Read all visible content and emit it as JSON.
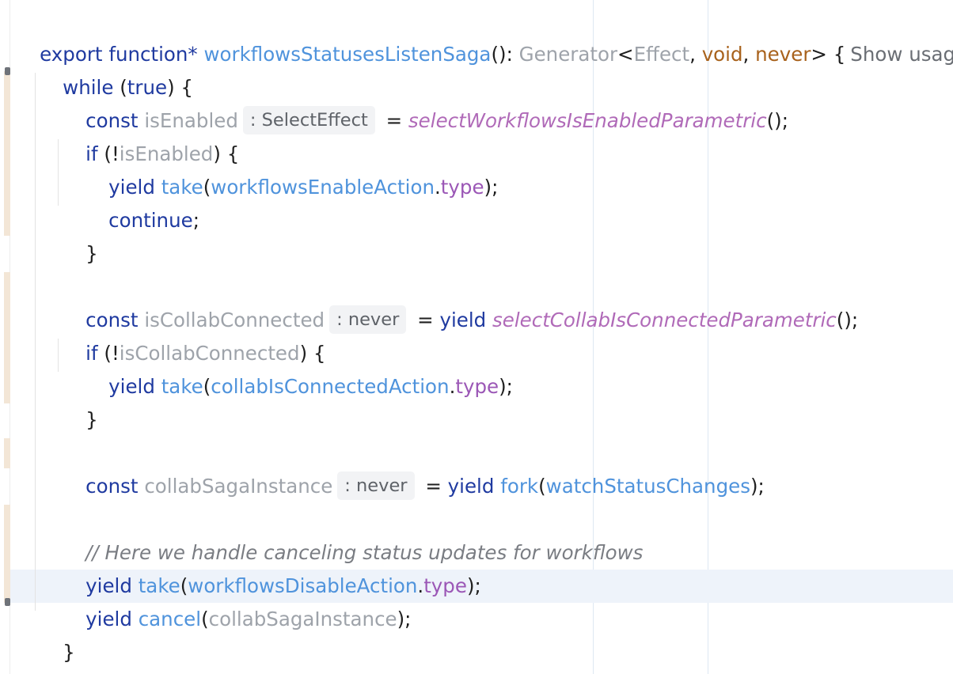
{
  "code": {
    "l1": {
      "kw1": "export",
      "kw2": "function*",
      "fn_name": "workflowsStatusesListenSaga",
      "paren": "():",
      "ret_type": "Generator",
      "lt": "<",
      "t1": "Effect",
      "c1": ",",
      "t2": "void",
      "c2": ",",
      "t3": "never",
      "gt": "> {",
      "usages": "Show usages"
    },
    "l2": {
      "kw": "while",
      "open": "(",
      "val": "true",
      "close": ") {"
    },
    "l3": {
      "kw": "const",
      "var": "isEnabled",
      "hint": ": SelectEffect",
      "eq": "=",
      "call": "selectWorkflowsIsEnabledParametric",
      "end": "();"
    },
    "l4": {
      "kw": "if",
      "open": "(!",
      "var": "isEnabled",
      "close": ") {"
    },
    "l5": {
      "kw": "yield",
      "fn": "take",
      "open": "(",
      "obj": "workflowsEnableAction",
      "dot": ".",
      "prop": "type",
      "end": ");"
    },
    "l6": {
      "kw": "continue",
      "end": ";"
    },
    "l7": {
      "brace": "}"
    },
    "l8": {
      "kw": "const",
      "var": "isCollabConnected",
      "hint": ": never",
      "eq": "=",
      "kw2": "yield",
      "call": "selectCollabIsConnectedParametric",
      "end": "();"
    },
    "l9": {
      "kw": "if",
      "open": "(!",
      "var": "isCollabConnected",
      "close": ") {"
    },
    "l10": {
      "kw": "yield",
      "fn": "take",
      "open": "(",
      "obj": "collabIsConnectedAction",
      "dot": ".",
      "prop": "type",
      "end": ");"
    },
    "l11": {
      "brace": "}"
    },
    "l12": {
      "kw": "const",
      "var": "collabSagaInstance",
      "hint": ": never",
      "eq": "=",
      "kw2": "yield",
      "fn": "fork",
      "open": "(",
      "arg": "watchStatusChanges",
      "end": ");"
    },
    "l13": {
      "comment": "// Here we handle canceling status updates for workflows"
    },
    "l14": {
      "kw": "yield",
      "fn": "take",
      "open": "(",
      "obj": "workflowsDisableAction",
      "dot": ".",
      "prop": "type",
      "end": ");"
    },
    "l15": {
      "kw": "yield",
      "fn": "cancel",
      "open": "(",
      "arg": "collabSagaInstance",
      "end": ");"
    },
    "l16": {
      "brace": "}"
    },
    "l17": {
      "brace": "}"
    }
  },
  "colors": {
    "keyword": "#1f3aa0",
    "function": "#4f93dc",
    "inactive": "#9ea3aa",
    "type": "#a8621c",
    "property": "#9b57b6",
    "comment": "#7a7d83",
    "current_line": "#eef3fa",
    "change_marker": "#f3e6d6"
  }
}
